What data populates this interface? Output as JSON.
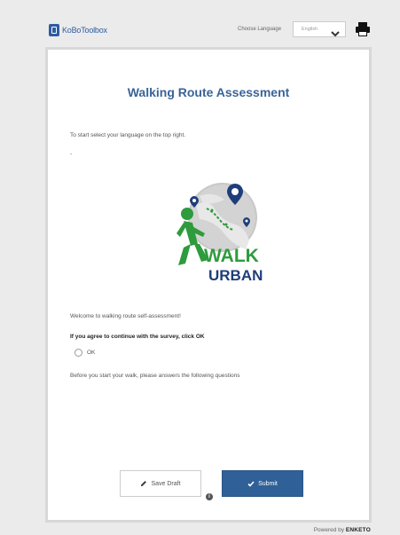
{
  "header": {
    "brand": "KoBoToolbox",
    "language_label": "Choose Language",
    "language_value": "English",
    "icons": {
      "brand": "kobo-logo-icon",
      "language_dropdown": "chevron-down-icon",
      "print": "printer-icon"
    }
  },
  "form": {
    "title": "Walking Route Assessment",
    "intro": "To start select your language on the top right.",
    "dash": "-",
    "logo_text": {
      "line1": "WALK",
      "line2": "URBAN"
    },
    "welcome": "Welcome to walking route self-assessment!",
    "question": "If you agree to continue with the survey, click OK",
    "option_ok": "OK",
    "before_text": "Before you start your walk, please answers the following questions"
  },
  "actions": {
    "save_draft": "Save Draft",
    "submit": "Submit",
    "icons": {
      "save_draft": "pencil-icon",
      "submit": "checkmark-icon",
      "info": "info-icon"
    }
  },
  "footer": {
    "powered_by": "Powered by",
    "brand": "ENKETO"
  },
  "colors": {
    "accent": "#2f6097",
    "title": "#3a6497",
    "logo_green": "#2e9b3d",
    "logo_navy": "#1f3d7a"
  }
}
